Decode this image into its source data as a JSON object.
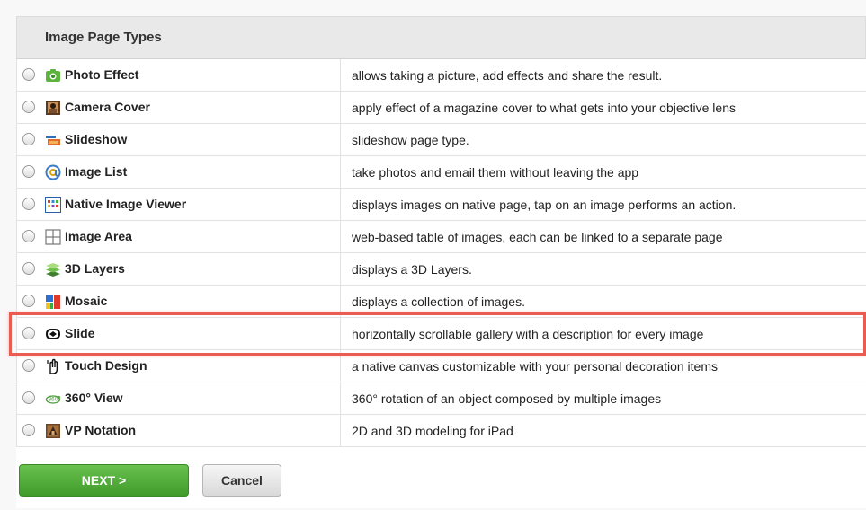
{
  "header": {
    "title": "Image Page Types"
  },
  "rows": [
    {
      "name": "Photo Effect",
      "description": "allows taking a picture, add effects and share the result.",
      "icon": "camera-green-icon"
    },
    {
      "name": "Camera Cover",
      "description": "apply effect of a magazine cover to what gets into your objective lens",
      "icon": "magazine-cover-icon"
    },
    {
      "name": "Slideshow",
      "description": "slideshow page type.",
      "icon": "slideshow-icon"
    },
    {
      "name": "Image List",
      "description": "take photos and email them without leaving the app",
      "icon": "at-sign-icon"
    },
    {
      "name": "Native Image Viewer",
      "description": "displays images on native page, tap on an image performs an action.",
      "icon": "image-grid-icon"
    },
    {
      "name": "Image Area",
      "description": "web-based table of images, each can be linked to a separate page",
      "icon": "table-grid-icon"
    },
    {
      "name": "3D Layers",
      "description": "displays a 3D Layers.",
      "icon": "layers-icon"
    },
    {
      "name": "Mosaic",
      "description": "displays a collection of images.",
      "icon": "mosaic-icon"
    },
    {
      "name": "Slide",
      "description": "horizontally scrollable gallery with a description for every image",
      "icon": "slide-gallery-icon"
    },
    {
      "name": "Touch Design",
      "description": "a native canvas customizable with your personal decoration items",
      "icon": "touch-hand-icon"
    },
    {
      "name": "360° View",
      "description": "360° rotation of an object composed by multiple images",
      "icon": "rotate-360-icon"
    },
    {
      "name": "VP Notation",
      "description": "2D and 3D modeling for iPad",
      "icon": "vp-notation-icon"
    }
  ],
  "buttons": {
    "next_label": "NEXT >",
    "cancel_label": "Cancel"
  },
  "colors": {
    "highlight": "#ea5b52",
    "next_button": "#4fae38",
    "header_bg": "#e9e9e9"
  }
}
